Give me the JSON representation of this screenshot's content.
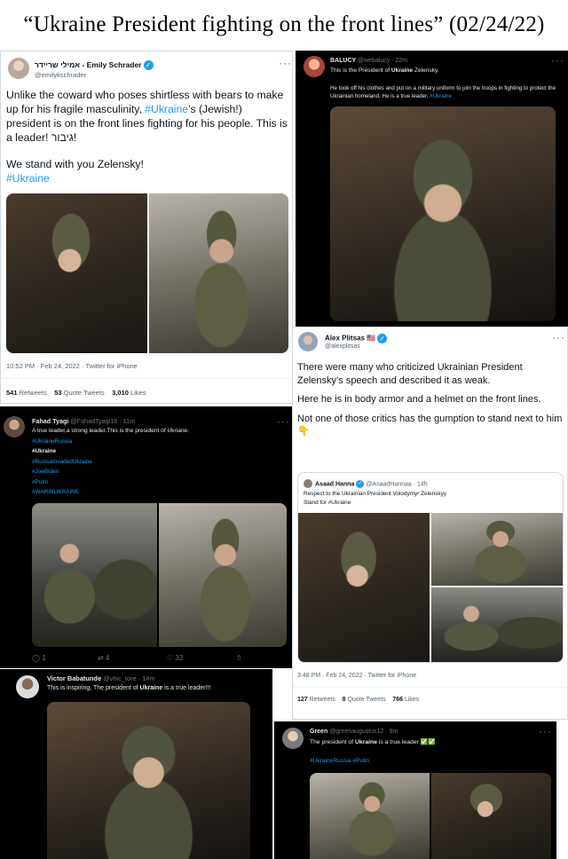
{
  "headline": "“Ukraine President fighting on the front lines” (02/24/22)",
  "tweets": {
    "emily": {
      "name": "אמילי שריידר - Emily Schrader",
      "handle": "@emilykschrader",
      "text_before_tag1": "Unlike the coward who poses shirtless with bears to make up for his fragile masculinity, ",
      "tag1": "#Ukraine",
      "text_after_tag1": "’s (Jewish!) president is on the front lines fighting for his people. This is a leader! גיבור!",
      "line2": "We stand with you Zelensky!",
      "tag2": "#Ukraine",
      "timestamp": "10:52 PM · Feb 24, 2022 · Twitter for iPhone",
      "retweets": "541",
      "retweets_label": "Retweets",
      "quotes": "53",
      "quotes_label": "Quote Tweets",
      "likes": "3,010",
      "likes_label": "Likes"
    },
    "balucy": {
      "name": "BALUCY",
      "handle": "@webalucy · 22m",
      "line1_before": "This is the President of ",
      "line1_bold": "Ukraine",
      "line1_after": " Zelensky.",
      "line2": "He took off his clothes and put on a military uniform to join the troops in fighting to protect the Ukrainian homeland. He is a true leader.",
      "tag": "#Ukraine"
    },
    "alex": {
      "name": "Alex Plitsas",
      "flag": "🇺🇸",
      "handle": "@alexplitsas",
      "para1": "There were many who criticized Ukrainian President Zelensky’s speech and described it as weak.",
      "para2": "Here he is in body armor and a helmet on the front lines.",
      "para3": "Not one of those critics has the gumption to stand next to him 👇",
      "quote_name": "Asaad Hanna",
      "quote_handle": "@AsaadHannaa · 14h",
      "quote_line1": "Respect to the Ukrainian President Volodymyr Zelenskyy",
      "quote_line2": "Stand for #Ukraine",
      "timestamp": "3:48 PM · Feb 24, 2022 · Twitter for iPhone",
      "retweets": "127",
      "retweets_label": "Retweets",
      "quotes": "8",
      "quotes_label": "Quote Tweets",
      "likes": "766",
      "likes_label": "Likes"
    },
    "fahad": {
      "name": "Fahad Tyagi",
      "handle": "@FahadTyagi16 · 11m",
      "line1": "A true leader,a strong leader.This is the president of Ukriane.",
      "tags": [
        "#UkraineRussia",
        "#Ukraine",
        "#RussiaInvadedUkraine",
        "#JoeBiden",
        "#Putin",
        "#WARINUKRAINE"
      ],
      "replies": "1",
      "retweets": "4",
      "likes": "32"
    },
    "victor": {
      "name": "Victor Babatunde",
      "handle": "@vhic_tore · 14m",
      "text_before": "This is inspiring, The president of ",
      "text_bold": "Ukraine",
      "text_after": " is a true leader!!!"
    },
    "green": {
      "name": "Green",
      "handle": "@greenaugustus12 · 9m",
      "text_before": "The president of ",
      "text_bold": "Ukraine",
      "text_after": " is a true leader ✅✅",
      "tags": "#UkraineRussia #Putin"
    }
  },
  "colors": {
    "twitter_blue": "#1d9bf0",
    "dark_bg": "#000000",
    "light_bg": "#ffffff"
  }
}
